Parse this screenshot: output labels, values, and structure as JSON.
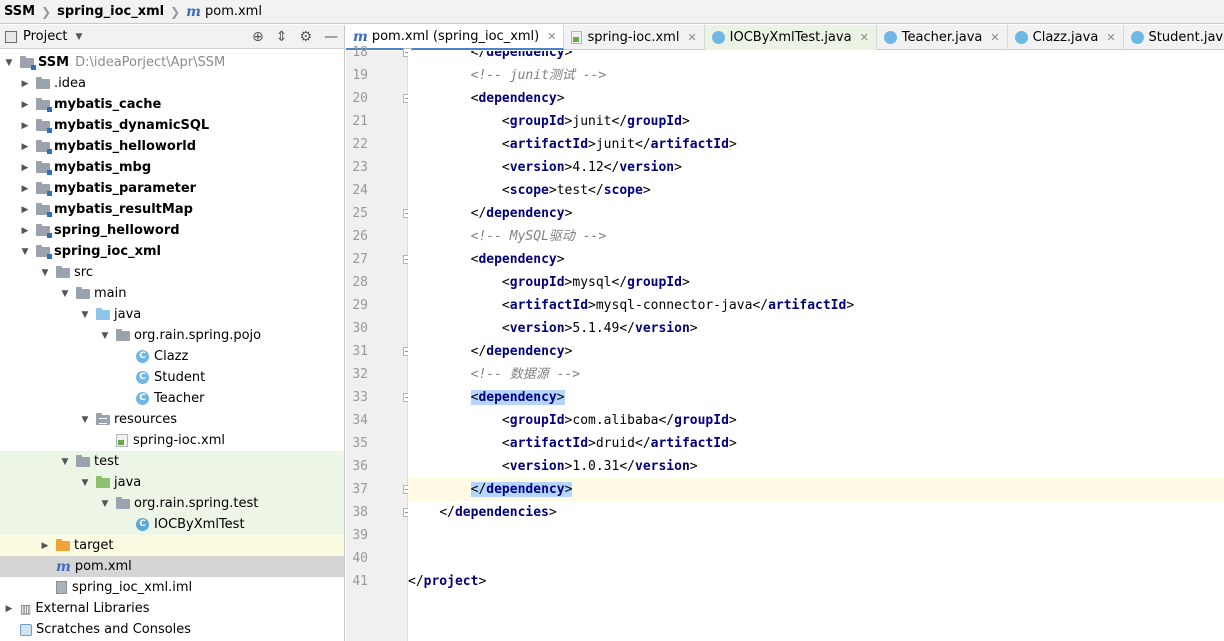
{
  "breadcrumb": [
    "SSM",
    "spring_ioc_xml",
    "pom.xml"
  ],
  "project_panel": {
    "title": "Project",
    "tree": [
      {
        "label": "SSM",
        "extra": "D:\\ideaPorject\\Apr\\SSM",
        "bold": true
      },
      {
        "label": ".idea"
      },
      {
        "label": "mybatis_cache",
        "bold": true
      },
      {
        "label": "mybatis_dynamicSQL",
        "bold": true
      },
      {
        "label": "mybatis_helloworld",
        "bold": true
      },
      {
        "label": "mybatis_mbg",
        "bold": true
      },
      {
        "label": "mybatis_parameter",
        "bold": true
      },
      {
        "label": "mybatis_resultMap",
        "bold": true
      },
      {
        "label": "spring_helloword",
        "bold": true
      },
      {
        "label": "spring_ioc_xml",
        "bold": true
      },
      {
        "label": "src"
      },
      {
        "label": "main"
      },
      {
        "label": "java"
      },
      {
        "label": "org.rain.spring.pojo"
      },
      {
        "label": "Clazz"
      },
      {
        "label": "Student"
      },
      {
        "label": "Teacher"
      },
      {
        "label": "resources"
      },
      {
        "label": "spring-ioc.xml"
      },
      {
        "label": "test"
      },
      {
        "label": "java"
      },
      {
        "label": "org.rain.spring.test"
      },
      {
        "label": "IOCByXmlTest"
      },
      {
        "label": "target"
      },
      {
        "label": "pom.xml"
      },
      {
        "label": "spring_ioc_xml.iml"
      },
      {
        "label": "External Libraries"
      },
      {
        "label": "Scratches and Consoles"
      }
    ]
  },
  "tabs": [
    {
      "label": "pom.xml (spring_ioc_xml)"
    },
    {
      "label": "spring-ioc.xml"
    },
    {
      "label": "IOCByXmlTest.java"
    },
    {
      "label": "Teacher.java"
    },
    {
      "label": "Clazz.java"
    },
    {
      "label": "Student.java"
    }
  ],
  "editor": {
    "line_numbers": [
      "18",
      "19",
      "20",
      "21",
      "22",
      "23",
      "24",
      "25",
      "26",
      "27",
      "28",
      "29",
      "30",
      "31",
      "32",
      "33",
      "34",
      "35",
      "36",
      "37",
      "38",
      "39",
      "40",
      "41"
    ],
    "lines": [
      {
        "indent": "        ",
        "parts": [
          [
            "br",
            "</"
          ],
          [
            "tag",
            "dependency"
          ],
          [
            "br",
            ">"
          ]
        ]
      },
      {
        "indent": "        ",
        "parts": [
          [
            "cmt",
            "<!-- junit测试 -->"
          ]
        ]
      },
      {
        "indent": "        ",
        "parts": [
          [
            "br",
            "<"
          ],
          [
            "tag",
            "dependency"
          ],
          [
            "br",
            ">"
          ]
        ]
      },
      {
        "indent": "            ",
        "parts": [
          [
            "br",
            "<"
          ],
          [
            "tag",
            "groupId"
          ],
          [
            "br",
            ">"
          ],
          [
            "txt",
            "junit"
          ],
          [
            "br",
            "</"
          ],
          [
            "tag",
            "groupId"
          ],
          [
            "br",
            ">"
          ]
        ]
      },
      {
        "indent": "            ",
        "parts": [
          [
            "br",
            "<"
          ],
          [
            "tag",
            "artifactId"
          ],
          [
            "br",
            ">"
          ],
          [
            "txt",
            "junit"
          ],
          [
            "br",
            "</"
          ],
          [
            "tag",
            "artifactId"
          ],
          [
            "br",
            ">"
          ]
        ]
      },
      {
        "indent": "            ",
        "parts": [
          [
            "br",
            "<"
          ],
          [
            "tag",
            "version"
          ],
          [
            "br",
            ">"
          ],
          [
            "txt",
            "4.12"
          ],
          [
            "br",
            "</"
          ],
          [
            "tag",
            "version"
          ],
          [
            "br",
            ">"
          ]
        ]
      },
      {
        "indent": "            ",
        "parts": [
          [
            "br",
            "<"
          ],
          [
            "tag",
            "scope"
          ],
          [
            "br",
            ">"
          ],
          [
            "txt",
            "test"
          ],
          [
            "br",
            "</"
          ],
          [
            "tag",
            "scope"
          ],
          [
            "br",
            ">"
          ]
        ]
      },
      {
        "indent": "        ",
        "parts": [
          [
            "br",
            "</"
          ],
          [
            "tag",
            "dependency"
          ],
          [
            "br",
            ">"
          ]
        ]
      },
      {
        "indent": "        ",
        "parts": [
          [
            "cmt",
            "<!-- MySQL驱动 -->"
          ]
        ]
      },
      {
        "indent": "        ",
        "parts": [
          [
            "br",
            "<"
          ],
          [
            "tag",
            "dependency"
          ],
          [
            "br",
            ">"
          ]
        ]
      },
      {
        "indent": "            ",
        "parts": [
          [
            "br",
            "<"
          ],
          [
            "tag",
            "groupId"
          ],
          [
            "br",
            ">"
          ],
          [
            "txt",
            "mysql"
          ],
          [
            "br",
            "</"
          ],
          [
            "tag",
            "groupId"
          ],
          [
            "br",
            ">"
          ]
        ]
      },
      {
        "indent": "            ",
        "parts": [
          [
            "br",
            "<"
          ],
          [
            "tag",
            "artifactId"
          ],
          [
            "br",
            ">"
          ],
          [
            "txt",
            "mysql-connector-java"
          ],
          [
            "br",
            "</"
          ],
          [
            "tag",
            "artifactId"
          ],
          [
            "br",
            ">"
          ]
        ]
      },
      {
        "indent": "            ",
        "parts": [
          [
            "br",
            "<"
          ],
          [
            "tag",
            "version"
          ],
          [
            "br",
            ">"
          ],
          [
            "txt",
            "5.1.49"
          ],
          [
            "br",
            "</"
          ],
          [
            "tag",
            "version"
          ],
          [
            "br",
            ">"
          ]
        ]
      },
      {
        "indent": "        ",
        "parts": [
          [
            "br",
            "</"
          ],
          [
            "tag",
            "dependency"
          ],
          [
            "br",
            ">"
          ]
        ]
      },
      {
        "indent": "        ",
        "parts": [
          [
            "cmt",
            "<!-- 数据源 -->"
          ]
        ]
      },
      {
        "indent": "        ",
        "parts": [
          [
            "br",
            "<"
          ],
          [
            "tag",
            "dependency"
          ],
          [
            "br",
            ">"
          ]
        ],
        "hl": true
      },
      {
        "indent": "            ",
        "parts": [
          [
            "br",
            "<"
          ],
          [
            "tag",
            "groupId"
          ],
          [
            "br",
            ">"
          ],
          [
            "txt",
            "com.alibaba"
          ],
          [
            "br",
            "</"
          ],
          [
            "tag",
            "groupId"
          ],
          [
            "br",
            ">"
          ]
        ]
      },
      {
        "indent": "            ",
        "parts": [
          [
            "br",
            "<"
          ],
          [
            "tag",
            "artifactId"
          ],
          [
            "br",
            ">"
          ],
          [
            "txt",
            "druid"
          ],
          [
            "br",
            "</"
          ],
          [
            "tag",
            "artifactId"
          ],
          [
            "br",
            ">"
          ]
        ]
      },
      {
        "indent": "            ",
        "parts": [
          [
            "br",
            "<"
          ],
          [
            "tag",
            "version"
          ],
          [
            "br",
            ">"
          ],
          [
            "txt",
            "1.0.31"
          ],
          [
            "br",
            "</"
          ],
          [
            "tag",
            "version"
          ],
          [
            "br",
            ">"
          ]
        ]
      },
      {
        "indent": "        ",
        "parts": [
          [
            "br",
            "</"
          ],
          [
            "tag",
            "dependency"
          ],
          [
            "br",
            ">"
          ]
        ],
        "hl": true,
        "current": true
      },
      {
        "indent": "    ",
        "parts": [
          [
            "br",
            "</"
          ],
          [
            "tag",
            "dependencies"
          ],
          [
            "br",
            ">"
          ]
        ]
      },
      {
        "indent": "",
        "parts": []
      },
      {
        "indent": "",
        "parts": []
      },
      {
        "indent": "",
        "parts": [
          [
            "br",
            "</"
          ],
          [
            "tag",
            "project"
          ],
          [
            "br",
            ">"
          ]
        ]
      }
    ]
  }
}
